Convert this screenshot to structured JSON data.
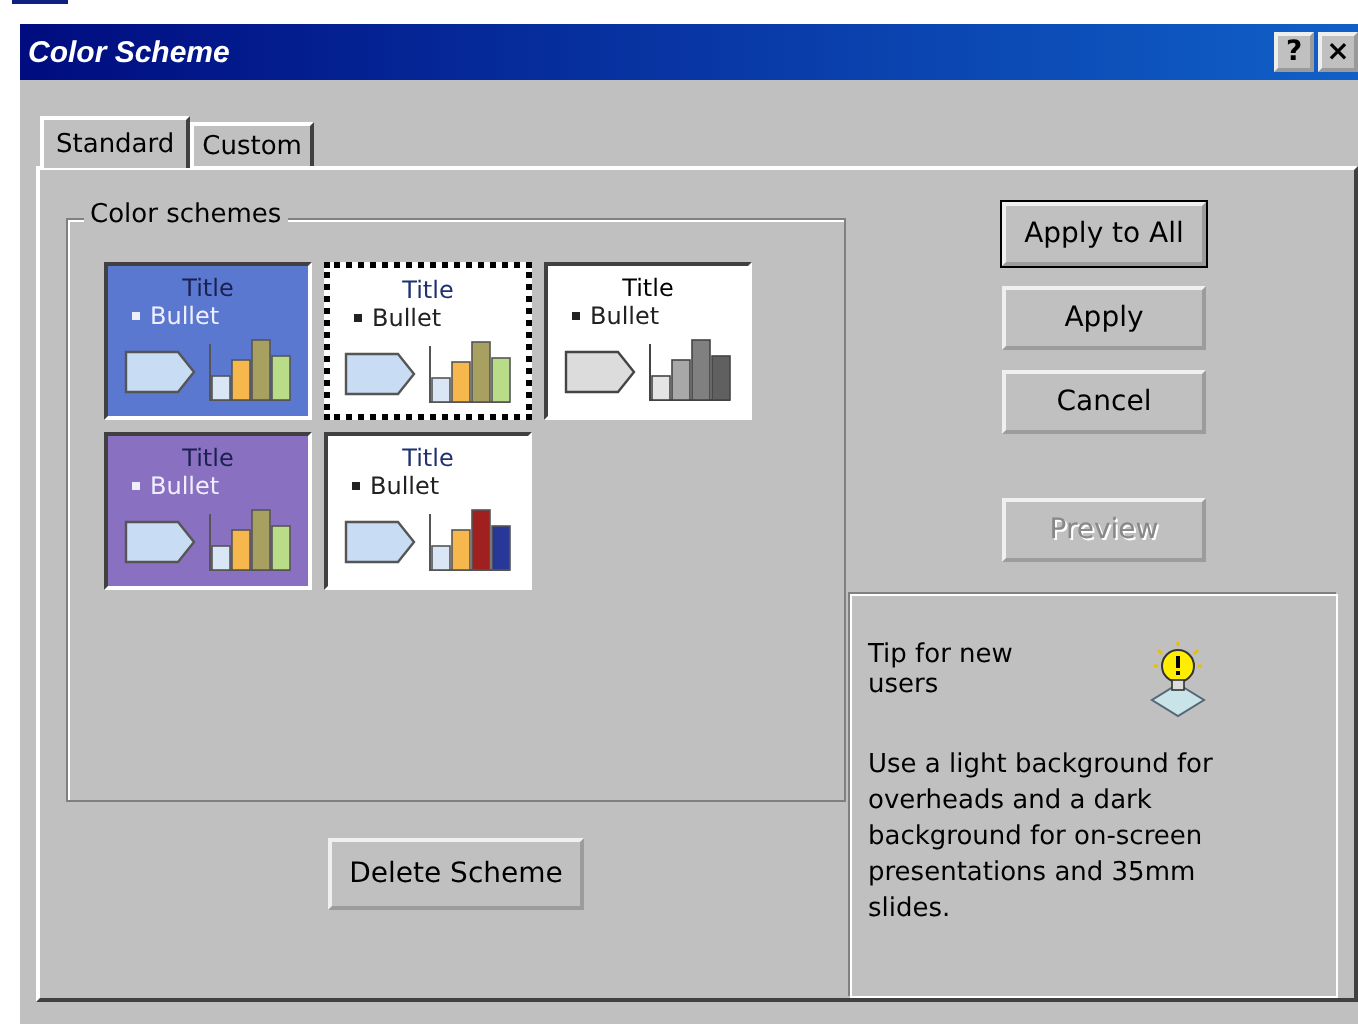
{
  "window": {
    "title": "Color Scheme",
    "help_button": "?",
    "close_button": "×"
  },
  "tabs": [
    {
      "label": "Standard",
      "selected": true
    },
    {
      "label": "Custom",
      "selected": false
    }
  ],
  "group": {
    "label": "Color schemes"
  },
  "schemes": [
    {
      "kind": "pastel",
      "color": "#5b78d0",
      "title": "Title",
      "bullet": "Bullet",
      "selected": false
    },
    {
      "kind": "pastel",
      "color": "#ffffff",
      "title": "Title",
      "bullet": "Bullet",
      "selected": true
    },
    {
      "kind": "gray",
      "color": "#ffffff",
      "title": "Title",
      "bullet": "Bullet",
      "selected": false
    },
    {
      "kind": "pastel",
      "color": "#8a70c0",
      "title": "Title",
      "bullet": "Bullet",
      "selected": false
    },
    {
      "kind": "bold",
      "color": "#ffffff",
      "title": "Title",
      "bullet": "Bullet",
      "selected": false
    }
  ],
  "buttons": [
    {
      "label": "Apply to All",
      "default": true,
      "disabled": false
    },
    {
      "label": "Apply",
      "default": false,
      "disabled": false
    },
    {
      "label": "Cancel",
      "default": false,
      "disabled": false
    },
    {
      "label": "Preview",
      "default": false,
      "disabled": true
    }
  ],
  "delete_button": "Delete Scheme",
  "tip": {
    "heading": "Tip for new users",
    "text": "Use a light background for overheads and a dark background for on-screen presentations and 35mm slides."
  }
}
